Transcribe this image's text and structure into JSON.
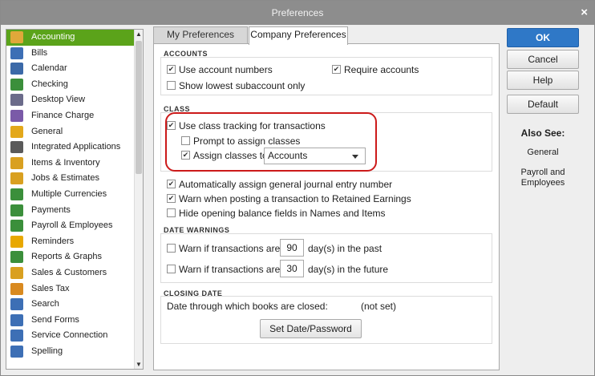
{
  "window": {
    "title": "Preferences",
    "close_glyph": "×"
  },
  "sidebar": {
    "items": [
      {
        "label": "Accounting",
        "icon": "accounting-icon",
        "color": "#e0a83a",
        "active": true
      },
      {
        "label": "Bills",
        "icon": "bills-icon",
        "color": "#3d6fb5"
      },
      {
        "label": "Calendar",
        "icon": "calendar-icon",
        "color": "#3b69a8"
      },
      {
        "label": "Checking",
        "icon": "checking-icon",
        "color": "#3b8f3b"
      },
      {
        "label": "Desktop View",
        "icon": "desktop-view-icon",
        "color": "#6b6b8a"
      },
      {
        "label": "Finance Charge",
        "icon": "finance-charge-icon",
        "color": "#7a5aa8"
      },
      {
        "label": "General",
        "icon": "general-icon",
        "color": "#e3a81a"
      },
      {
        "label": "Integrated Applications",
        "icon": "integrated-apps-icon",
        "color": "#5a5a5a"
      },
      {
        "label": "Items & Inventory",
        "icon": "items-inventory-icon",
        "color": "#d9a020"
      },
      {
        "label": "Jobs & Estimates",
        "icon": "jobs-estimates-icon",
        "color": "#d9a020"
      },
      {
        "label": "Multiple Currencies",
        "icon": "multiple-currencies-icon",
        "color": "#3b8f3b"
      },
      {
        "label": "Payments",
        "icon": "payments-icon",
        "color": "#3b8f3b"
      },
      {
        "label": "Payroll & Employees",
        "icon": "payroll-employees-icon",
        "color": "#3b8f3b"
      },
      {
        "label": "Reminders",
        "icon": "reminders-icon",
        "color": "#e8a800"
      },
      {
        "label": "Reports & Graphs",
        "icon": "reports-graphs-icon",
        "color": "#3b8f3b"
      },
      {
        "label": "Sales & Customers",
        "icon": "sales-customers-icon",
        "color": "#d9a020"
      },
      {
        "label": "Sales Tax",
        "icon": "sales-tax-icon",
        "color": "#d98a20"
      },
      {
        "label": "Search",
        "icon": "search-icon",
        "color": "#3d6fb5"
      },
      {
        "label": "Send Forms",
        "icon": "send-forms-icon",
        "color": "#3d6fb5"
      },
      {
        "label": "Service Connection",
        "icon": "service-connection-icon",
        "color": "#3d6fb5"
      },
      {
        "label": "Spelling",
        "icon": "spelling-icon",
        "color": "#3d6fb5"
      }
    ]
  },
  "tabs": {
    "my": "My Preferences",
    "company": "Company Preferences"
  },
  "accounts": {
    "section_label": "ACCOUNTS",
    "use_account_numbers": "Use account numbers",
    "require_accounts": "Require accounts",
    "show_lowest_subaccount": "Show lowest subaccount only"
  },
  "class": {
    "section_label": "CLASS",
    "use_class_tracking": "Use class tracking for transactions",
    "prompt_to_assign": "Prompt to assign classes",
    "assign_classes_to": "Assign classes to",
    "assign_value": "Accounts"
  },
  "misc": {
    "auto_assign_journal": "Automatically assign general journal entry number",
    "warn_retained": "Warn when posting a transaction to Retained Earnings",
    "hide_opening_balance": "Hide opening balance fields in Names and Items"
  },
  "date_warnings": {
    "section_label": "DATE WARNINGS",
    "warn_label": "Warn if transactions are",
    "past_days": "90",
    "past_suffix": "day(s) in the past",
    "future_days": "30",
    "future_suffix": "day(s) in the future"
  },
  "closing_date": {
    "section_label": "CLOSING DATE",
    "description": "Date through which books are closed:",
    "value": "(not set)",
    "button": "Set Date/Password"
  },
  "buttons": {
    "ok": "OK",
    "cancel": "Cancel",
    "help": "Help",
    "default": "Default"
  },
  "also_see": {
    "heading": "Also See:",
    "general": "General",
    "payroll": "Payroll and Employees"
  },
  "check_glyph": "✔",
  "colors": {
    "accent": "#2f78c7",
    "active_sidebar": "#5ba31a",
    "highlight": "#cc1a1a"
  }
}
